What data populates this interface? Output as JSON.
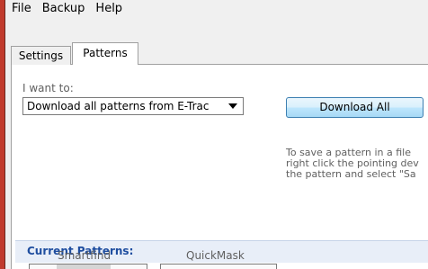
{
  "menu": {
    "items": [
      "File",
      "Backup",
      "Help"
    ]
  },
  "tabs": {
    "settings": "Settings",
    "patterns": "Patterns"
  },
  "patterns_tab": {
    "want_label": "I want to:",
    "select_value": "Download all patterns from E-Trac",
    "download_all_label": "Download All",
    "save_info": "To save a pattern in a file\nright click the pointing dev\nthe pattern and select \"Sa"
  },
  "current_patterns": {
    "title": "Current Patterns:",
    "columns": [
      "Smartfind",
      "QuickMask"
    ]
  },
  "colors": {
    "window_border": "#c13b2d",
    "section_title": "#1e4d9f",
    "button_border": "#3c7fb1"
  }
}
